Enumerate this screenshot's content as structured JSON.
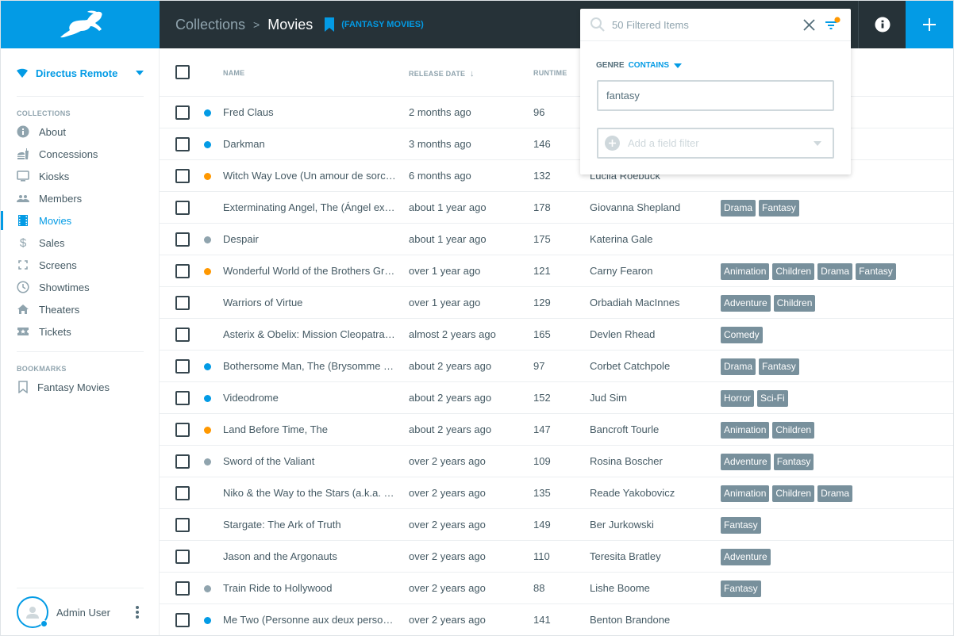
{
  "sidebar": {
    "project": "Directus Remote",
    "collections_title": "COLLECTIONS",
    "collections": [
      {
        "label": "About",
        "icon": "info-icon"
      },
      {
        "label": "Concessions",
        "icon": "fastfood-icon"
      },
      {
        "label": "Kiosks",
        "icon": "monitor-icon"
      },
      {
        "label": "Members",
        "icon": "people-icon"
      },
      {
        "label": "Movies",
        "icon": "film-icon",
        "active": true
      },
      {
        "label": "Sales",
        "icon": "dollar-icon"
      },
      {
        "label": "Screens",
        "icon": "fullscreen-icon"
      },
      {
        "label": "Showtimes",
        "icon": "clock-icon"
      },
      {
        "label": "Theaters",
        "icon": "home-icon"
      },
      {
        "label": "Tickets",
        "icon": "ticket-icon"
      }
    ],
    "bookmarks_title": "BOOKMARKS",
    "bookmarks": [
      {
        "label": "Fantasy Movies",
        "icon": "bookmark-outline-icon"
      }
    ],
    "user": {
      "name": "Admin User"
    }
  },
  "header": {
    "breadcrumb_root": "Collections",
    "breadcrumb_separator": ">",
    "title": "Movies",
    "bookmark_label": "(FANTASY MOVIES)"
  },
  "search": {
    "placeholder": "50 Filtered Items",
    "value": ""
  },
  "filter": {
    "field": "GENRE",
    "operator": "CONTAINS",
    "value": "fantasy",
    "add_placeholder": "Add a field filter"
  },
  "colors": {
    "accent": "#039be5",
    "header_bg": "#263238",
    "status_published": "#039be5",
    "status_draft": "#ff9800",
    "status_archived": "#90a4ae",
    "tag_bg": "#78909c",
    "filter_indicator": "#ff9800"
  },
  "table": {
    "columns": [
      "NAME",
      "RELEASE DATE",
      "RUNTIME"
    ],
    "sort_column": "RELEASE DATE",
    "sort_direction": "descending",
    "rows": [
      {
        "status": "published",
        "name": "Fred Claus",
        "release": "2 months ago",
        "runtime": "96",
        "director": "",
        "genres": []
      },
      {
        "status": "published",
        "name": "Darkman",
        "release": "3 months ago",
        "runtime": "146",
        "director": "",
        "genres": []
      },
      {
        "status": "draft",
        "name": "Witch Way Love (Un amour de sorc…",
        "release": "6 months ago",
        "runtime": "132",
        "director": "Lucila Roebuck",
        "genres": []
      },
      {
        "status": "none",
        "name": "Exterminating Angel, The (Ángel ex…",
        "release": "about 1 year ago",
        "runtime": "178",
        "director": "Giovanna Shepland",
        "genres": [
          "Drama",
          "Fantasy"
        ]
      },
      {
        "status": "archived",
        "name": "Despair",
        "release": "about 1 year ago",
        "runtime": "175",
        "director": "Katerina Gale",
        "genres": []
      },
      {
        "status": "draft",
        "name": "Wonderful World of the Brothers Gr…",
        "release": "over 1 year ago",
        "runtime": "121",
        "director": "Carny Fearon",
        "genres": [
          "Animation",
          "Children",
          "Drama",
          "Fantasy"
        ]
      },
      {
        "status": "none",
        "name": "Warriors of Virtue",
        "release": "over 1 year ago",
        "runtime": "129",
        "director": "Orbadiah MacInnes",
        "genres": [
          "Adventure",
          "Children"
        ]
      },
      {
        "status": "none",
        "name": "Asterix & Obelix: Mission Cleopatra…",
        "release": "almost 2 years ago",
        "runtime": "165",
        "director": "Devlen Rhead",
        "genres": [
          "Comedy"
        ]
      },
      {
        "status": "published",
        "name": "Bothersome Man, The (Brysomme …",
        "release": "about 2 years ago",
        "runtime": "97",
        "director": "Corbet Catchpole",
        "genres": [
          "Drama",
          "Fantasy"
        ]
      },
      {
        "status": "published",
        "name": "Videodrome",
        "release": "about 2 years ago",
        "runtime": "152",
        "director": "Jud Sim",
        "genres": [
          "Horror",
          "Sci-Fi"
        ]
      },
      {
        "status": "draft",
        "name": "Land Before Time, The",
        "release": "about 2 years ago",
        "runtime": "147",
        "director": "Bancroft Tourle",
        "genres": [
          "Animation",
          "Children"
        ]
      },
      {
        "status": "archived",
        "name": "Sword of the Valiant",
        "release": "over 2 years ago",
        "runtime": "109",
        "director": "Rosina Boscher",
        "genres": [
          "Adventure",
          "Fantasy"
        ]
      },
      {
        "status": "none",
        "name": "Niko & the Way to the Stars (a.k.a. …",
        "release": "over 2 years ago",
        "runtime": "135",
        "director": "Reade Yakobovicz",
        "genres": [
          "Animation",
          "Children",
          "Drama"
        ]
      },
      {
        "status": "none",
        "name": "Stargate: The Ark of Truth",
        "release": "over 2 years ago",
        "runtime": "149",
        "director": "Ber Jurkowski",
        "genres": [
          "Fantasy"
        ]
      },
      {
        "status": "none",
        "name": "Jason and the Argonauts",
        "release": "over 2 years ago",
        "runtime": "110",
        "director": "Teresita Bratley",
        "genres": [
          "Adventure"
        ]
      },
      {
        "status": "archived",
        "name": "Train Ride to Hollywood",
        "release": "over 2 years ago",
        "runtime": "88",
        "director": "Lishe Boome",
        "genres": [
          "Fantasy"
        ]
      },
      {
        "status": "published",
        "name": "Me Two (Personne aux deux perso…",
        "release": "over 2 years ago",
        "runtime": "141",
        "director": "Benton Brandone",
        "genres": []
      }
    ]
  }
}
